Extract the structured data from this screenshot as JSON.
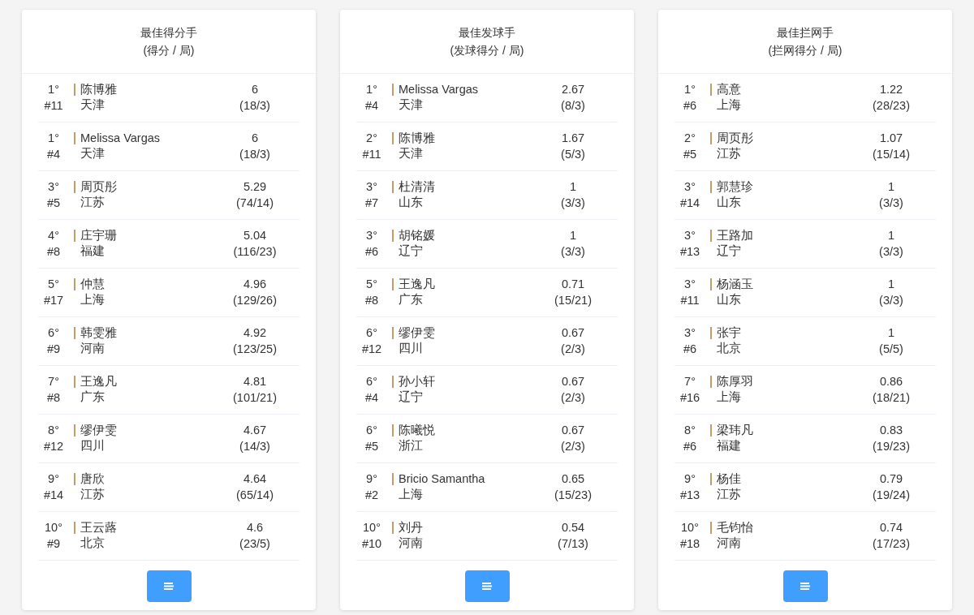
{
  "panels": [
    {
      "title": "最佳得分手",
      "subtitle": "(得分 / 局)",
      "rows": [
        {
          "rank": "1°",
          "number": "#11",
          "name": "陈博雅",
          "team": "天津",
          "value": "6",
          "ratio": "(18/3)"
        },
        {
          "rank": "1°",
          "number": "#4",
          "name": "Melissa Vargas",
          "team": "天津",
          "value": "6",
          "ratio": "(18/3)"
        },
        {
          "rank": "3°",
          "number": "#5",
          "name": "周页彤",
          "team": "江苏",
          "value": "5.29",
          "ratio": "(74/14)"
        },
        {
          "rank": "4°",
          "number": "#8",
          "name": "庄宇珊",
          "team": "福建",
          "value": "5.04",
          "ratio": "(116/23)"
        },
        {
          "rank": "5°",
          "number": "#17",
          "name": "仲慧",
          "team": "上海",
          "value": "4.96",
          "ratio": "(129/26)"
        },
        {
          "rank": "6°",
          "number": "#9",
          "name": "韩雯雅",
          "team": "河南",
          "value": "4.92",
          "ratio": "(123/25)"
        },
        {
          "rank": "7°",
          "number": "#8",
          "name": "王逸凡",
          "team": "广东",
          "value": "4.81",
          "ratio": "(101/21)"
        },
        {
          "rank": "8°",
          "number": "#12",
          "name": "缪伊雯",
          "team": "四川",
          "value": "4.67",
          "ratio": "(14/3)"
        },
        {
          "rank": "9°",
          "number": "#14",
          "name": "唐欣",
          "team": "江苏",
          "value": "4.64",
          "ratio": "(65/14)"
        },
        {
          "rank": "10°",
          "number": "#9",
          "name": "王云蕗",
          "team": "北京",
          "value": "4.6",
          "ratio": "(23/5)"
        }
      ]
    },
    {
      "title": "最佳发球手",
      "subtitle": "(发球得分 / 局)",
      "rows": [
        {
          "rank": "1°",
          "number": "#4",
          "name": "Melissa Vargas",
          "team": "天津",
          "value": "2.67",
          "ratio": "(8/3)"
        },
        {
          "rank": "2°",
          "number": "#11",
          "name": "陈博雅",
          "team": "天津",
          "value": "1.67",
          "ratio": "(5/3)"
        },
        {
          "rank": "3°",
          "number": "#7",
          "name": "杜清清",
          "team": "山东",
          "value": "1",
          "ratio": "(3/3)"
        },
        {
          "rank": "3°",
          "number": "#6",
          "name": "胡铭媛",
          "team": "辽宁",
          "value": "1",
          "ratio": "(3/3)"
        },
        {
          "rank": "5°",
          "number": "#8",
          "name": "王逸凡",
          "team": "广东",
          "value": "0.71",
          "ratio": "(15/21)"
        },
        {
          "rank": "6°",
          "number": "#12",
          "name": "缪伊雯",
          "team": "四川",
          "value": "0.67",
          "ratio": "(2/3)"
        },
        {
          "rank": "6°",
          "number": "#4",
          "name": "孙小轩",
          "team": "辽宁",
          "value": "0.67",
          "ratio": "(2/3)"
        },
        {
          "rank": "6°",
          "number": "#5",
          "name": "陈曦悦",
          "team": "浙江",
          "value": "0.67",
          "ratio": "(2/3)"
        },
        {
          "rank": "9°",
          "number": "#2",
          "name": "Bricio Samantha",
          "team": "上海",
          "value": "0.65",
          "ratio": "(15/23)"
        },
        {
          "rank": "10°",
          "number": "#10",
          "name": "刘丹",
          "team": "河南",
          "value": "0.54",
          "ratio": "(7/13)"
        }
      ]
    },
    {
      "title": "最佳拦网手",
      "subtitle": "(拦网得分 / 局)",
      "rows": [
        {
          "rank": "1°",
          "number": "#6",
          "name": "高意",
          "team": "上海",
          "value": "1.22",
          "ratio": "(28/23)"
        },
        {
          "rank": "2°",
          "number": "#5",
          "name": "周页彤",
          "team": "江苏",
          "value": "1.07",
          "ratio": "(15/14)"
        },
        {
          "rank": "3°",
          "number": "#14",
          "name": "郭慧珍",
          "team": "山东",
          "value": "1",
          "ratio": "(3/3)"
        },
        {
          "rank": "3°",
          "number": "#13",
          "name": "王路加",
          "team": "辽宁",
          "value": "1",
          "ratio": "(3/3)"
        },
        {
          "rank": "3°",
          "number": "#11",
          "name": "杨涵玉",
          "team": "山东",
          "value": "1",
          "ratio": "(3/3)"
        },
        {
          "rank": "3°",
          "number": "#6",
          "name": "张宇",
          "team": "北京",
          "value": "1",
          "ratio": "(5/5)"
        },
        {
          "rank": "7°",
          "number": "#16",
          "name": "陈厚羽",
          "team": "上海",
          "value": "0.86",
          "ratio": "(18/21)"
        },
        {
          "rank": "8°",
          "number": "#6",
          "name": "梁玮凡",
          "team": "福建",
          "value": "0.83",
          "ratio": "(19/23)"
        },
        {
          "rank": "9°",
          "number": "#13",
          "name": "杨佳",
          "team": "江苏",
          "value": "0.79",
          "ratio": "(19/24)"
        },
        {
          "rank": "10°",
          "number": "#18",
          "name": "毛钧怡",
          "team": "河南",
          "value": "0.74",
          "ratio": "(17/23)"
        }
      ]
    }
  ]
}
